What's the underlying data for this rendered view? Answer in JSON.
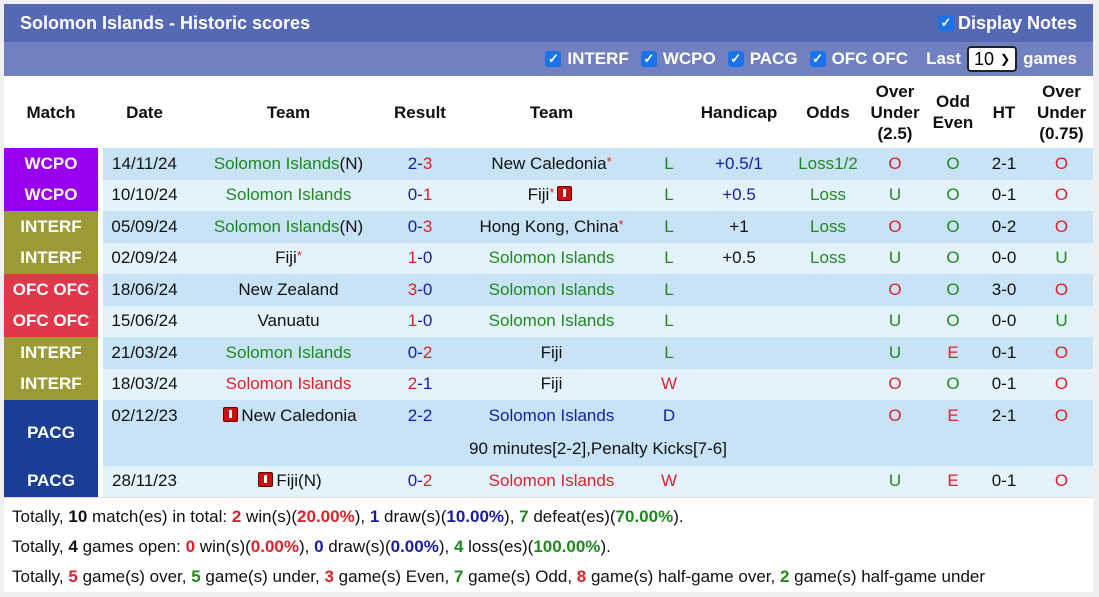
{
  "header": {
    "title": "Solomon Islands - Historic scores",
    "display_notes_label": "Display Notes",
    "display_notes_checked": true
  },
  "filters": {
    "items": [
      {
        "label": "INTERF",
        "checked": true
      },
      {
        "label": "WCPO",
        "checked": true
      },
      {
        "label": "PACG",
        "checked": true
      },
      {
        "label": "OFC OFC",
        "checked": true
      }
    ],
    "last_label": "Last",
    "last_value": "10",
    "games_label": "games"
  },
  "columns": {
    "match": "Match",
    "date": "Date",
    "team_home": "Team",
    "result": "Result",
    "team_away": "Team",
    "handicap": "Handicap",
    "odds": "Odds",
    "ou_line1": "Over",
    "ou_line2": "Under",
    "ou_line3": "(2.5)",
    "oe_line1": "Odd",
    "oe_line2": "Even",
    "ht": "HT",
    "ou2_line1": "Over",
    "ou2_line2": "Under",
    "ou2_line3": "(0.75)"
  },
  "colors": {
    "WCPO": "#9a00f0",
    "INTERF": "#9b9b35",
    "OFC OFC": "#e0384a",
    "PACG": "#1a3d96"
  },
  "rows": [
    {
      "league": "WCPO",
      "date": "14/11/24",
      "home": "Solomon Islands",
      "home_suffix": "(N)",
      "home_color": "green",
      "home_star": false,
      "home_card": false,
      "score_h": "2",
      "score_a": "3",
      "score_h_color": "navy",
      "score_a_color": "red",
      "away": "New Caledonia",
      "away_color": "black",
      "away_star": true,
      "away_card": false,
      "wl": "L",
      "wl_color": "green",
      "handicap": "+0.5/1",
      "handicap_color": "navy",
      "odds": "Loss1/2",
      "ou": "O",
      "ou_color": "red",
      "oe": "O",
      "oe_color": "green",
      "ht": "2-1",
      "ou2": "O",
      "ou2_color": "red"
    },
    {
      "league": "WCPO",
      "date": "10/10/24",
      "home": "Solomon Islands",
      "home_suffix": "",
      "home_color": "green",
      "home_star": false,
      "home_card": false,
      "score_h": "0",
      "score_a": "1",
      "score_h_color": "navy",
      "score_a_color": "red",
      "away": "Fiji",
      "away_color": "black",
      "away_star": true,
      "away_card": true,
      "wl": "L",
      "wl_color": "green",
      "handicap": "+0.5",
      "handicap_color": "navy",
      "odds": "Loss",
      "ou": "U",
      "ou_color": "green",
      "oe": "O",
      "oe_color": "green",
      "ht": "0-1",
      "ou2": "O",
      "ou2_color": "red"
    },
    {
      "league": "INTERF",
      "date": "05/09/24",
      "home": "Solomon Islands",
      "home_suffix": "(N)",
      "home_color": "green",
      "home_star": false,
      "home_card": false,
      "score_h": "0",
      "score_a": "3",
      "score_h_color": "navy",
      "score_a_color": "red",
      "away": "Hong Kong, China",
      "away_color": "black",
      "away_star": true,
      "away_card": false,
      "wl": "L",
      "wl_color": "green",
      "handicap": "+1",
      "handicap_color": "black",
      "odds": "Loss",
      "ou": "O",
      "ou_color": "red",
      "oe": "O",
      "oe_color": "green",
      "ht": "0-2",
      "ou2": "O",
      "ou2_color": "red"
    },
    {
      "league": "INTERF",
      "date": "02/09/24",
      "home": "Fiji",
      "home_suffix": "",
      "home_color": "black",
      "home_star": true,
      "home_card": false,
      "score_h": "1",
      "score_a": "0",
      "score_h_color": "red",
      "score_a_color": "navy",
      "away": "Solomon Islands",
      "away_color": "green",
      "away_star": false,
      "away_card": false,
      "wl": "L",
      "wl_color": "green",
      "handicap": "+0.5",
      "handicap_color": "black",
      "odds": "Loss",
      "ou": "U",
      "ou_color": "green",
      "oe": "O",
      "oe_color": "green",
      "ht": "0-0",
      "ou2": "U",
      "ou2_color": "green"
    },
    {
      "league": "OFC OFC",
      "date": "18/06/24",
      "home": "New Zealand",
      "home_suffix": "",
      "home_color": "black",
      "home_star": false,
      "home_card": false,
      "score_h": "3",
      "score_a": "0",
      "score_h_color": "red",
      "score_a_color": "navy",
      "away": "Solomon Islands",
      "away_color": "green",
      "away_star": false,
      "away_card": false,
      "wl": "L",
      "wl_color": "green",
      "handicap": "",
      "handicap_color": "black",
      "odds": "",
      "ou": "O",
      "ou_color": "red",
      "oe": "O",
      "oe_color": "green",
      "ht": "3-0",
      "ou2": "O",
      "ou2_color": "red"
    },
    {
      "league": "OFC OFC",
      "date": "15/06/24",
      "home": "Vanuatu",
      "home_suffix": "",
      "home_color": "black",
      "home_star": false,
      "home_card": false,
      "score_h": "1",
      "score_a": "0",
      "score_h_color": "red",
      "score_a_color": "navy",
      "away": "Solomon Islands",
      "away_color": "green",
      "away_star": false,
      "away_card": false,
      "wl": "L",
      "wl_color": "green",
      "handicap": "",
      "handicap_color": "black",
      "odds": "",
      "ou": "U",
      "ou_color": "green",
      "oe": "O",
      "oe_color": "green",
      "ht": "0-0",
      "ou2": "U",
      "ou2_color": "green"
    },
    {
      "league": "INTERF",
      "date": "21/03/24",
      "home": "Solomon Islands",
      "home_suffix": "",
      "home_color": "green",
      "home_star": false,
      "home_card": false,
      "score_h": "0",
      "score_a": "2",
      "score_h_color": "navy",
      "score_a_color": "red",
      "away": "Fiji",
      "away_color": "black",
      "away_star": false,
      "away_card": false,
      "wl": "L",
      "wl_color": "green",
      "handicap": "",
      "handicap_color": "black",
      "odds": "",
      "ou": "U",
      "ou_color": "green",
      "oe": "E",
      "oe_color": "red",
      "ht": "0-1",
      "ou2": "O",
      "ou2_color": "red"
    },
    {
      "league": "INTERF",
      "date": "18/03/24",
      "home": "Solomon Islands",
      "home_suffix": "",
      "home_color": "red",
      "home_star": false,
      "home_card": false,
      "score_h": "2",
      "score_a": "1",
      "score_h_color": "red",
      "score_a_color": "navy",
      "away": "Fiji",
      "away_color": "black",
      "away_star": false,
      "away_card": false,
      "wl": "W",
      "wl_color": "red",
      "handicap": "",
      "handicap_color": "black",
      "odds": "",
      "ou": "O",
      "ou_color": "red",
      "oe": "O",
      "oe_color": "green",
      "ht": "0-1",
      "ou2": "O",
      "ou2_color": "red"
    },
    {
      "league": "PACG",
      "date": "02/12/23",
      "home": "New Caledonia",
      "home_suffix": "",
      "home_color": "black",
      "home_star": false,
      "home_card": true,
      "score_h": "2",
      "score_a": "2",
      "score_h_color": "navy",
      "score_a_color": "navy",
      "away": "Solomon Islands",
      "away_color": "navy",
      "away_star": false,
      "away_card": false,
      "wl": "D",
      "wl_color": "navy",
      "handicap": "",
      "handicap_color": "black",
      "odds": "",
      "ou": "O",
      "ou_color": "red",
      "oe": "E",
      "oe_color": "red",
      "ht": "2-1",
      "ou2": "O",
      "ou2_color": "red",
      "note": "90 minutes[2-2],Penalty Kicks[7-6]"
    },
    {
      "league": "PACG",
      "date": "28/11/23",
      "home": "Fiji",
      "home_suffix": "(N)",
      "home_color": "black",
      "home_star": false,
      "home_card": true,
      "score_h": "0",
      "score_a": "2",
      "score_h_color": "navy",
      "score_a_color": "red",
      "away": "Solomon Islands",
      "away_color": "red",
      "away_star": false,
      "away_card": false,
      "wl": "W",
      "wl_color": "red",
      "handicap": "",
      "handicap_color": "black",
      "odds": "",
      "ou": "U",
      "ou_color": "green",
      "oe": "E",
      "oe_color": "red",
      "ht": "0-1",
      "ou2": "O",
      "ou2_color": "red"
    }
  ],
  "summary": [
    [
      {
        "t": "Totally, ",
        "c": "black",
        "b": false
      },
      {
        "t": "10",
        "c": "black",
        "b": true
      },
      {
        "t": " match(es) in total: ",
        "c": "black",
        "b": false
      },
      {
        "t": "2",
        "c": "red",
        "b": true
      },
      {
        "t": " win(s)(",
        "c": "black",
        "b": false
      },
      {
        "t": "20.00%",
        "c": "red",
        "b": true
      },
      {
        "t": "), ",
        "c": "black",
        "b": false
      },
      {
        "t": "1",
        "c": "navy",
        "b": true
      },
      {
        "t": " draw(s)(",
        "c": "black",
        "b": false
      },
      {
        "t": "10.00%",
        "c": "navy",
        "b": true
      },
      {
        "t": "), ",
        "c": "black",
        "b": false
      },
      {
        "t": "7",
        "c": "green",
        "b": true
      },
      {
        "t": " defeat(es)(",
        "c": "black",
        "b": false
      },
      {
        "t": "70.00%",
        "c": "green",
        "b": true
      },
      {
        "t": ").",
        "c": "black",
        "b": false
      }
    ],
    [
      {
        "t": "Totally, ",
        "c": "black",
        "b": false
      },
      {
        "t": "4",
        "c": "black",
        "b": true
      },
      {
        "t": " games open: ",
        "c": "black",
        "b": false
      },
      {
        "t": "0",
        "c": "red",
        "b": true
      },
      {
        "t": " win(s)(",
        "c": "black",
        "b": false
      },
      {
        "t": "0.00%",
        "c": "red",
        "b": true
      },
      {
        "t": "), ",
        "c": "black",
        "b": false
      },
      {
        "t": "0",
        "c": "navy",
        "b": true
      },
      {
        "t": " draw(s)(",
        "c": "black",
        "b": false
      },
      {
        "t": "0.00%",
        "c": "navy",
        "b": true
      },
      {
        "t": "), ",
        "c": "black",
        "b": false
      },
      {
        "t": "4",
        "c": "green",
        "b": true
      },
      {
        "t": " loss(es)(",
        "c": "black",
        "b": false
      },
      {
        "t": "100.00%",
        "c": "green",
        "b": true
      },
      {
        "t": ").",
        "c": "black",
        "b": false
      }
    ],
    [
      {
        "t": "Totally, ",
        "c": "black",
        "b": false
      },
      {
        "t": "5",
        "c": "red",
        "b": true
      },
      {
        "t": " game(s) over, ",
        "c": "black",
        "b": false
      },
      {
        "t": "5",
        "c": "green",
        "b": true
      },
      {
        "t": " game(s) under, ",
        "c": "black",
        "b": false
      },
      {
        "t": "3",
        "c": "red",
        "b": true
      },
      {
        "t": " game(s) Even, ",
        "c": "black",
        "b": false
      },
      {
        "t": "7",
        "c": "green",
        "b": true
      },
      {
        "t": " game(s) Odd, ",
        "c": "black",
        "b": false
      },
      {
        "t": "8",
        "c": "red",
        "b": true
      },
      {
        "t": " game(s) half-game over, ",
        "c": "black",
        "b": false
      },
      {
        "t": "2",
        "c": "green",
        "b": true
      },
      {
        "t": " game(s) half-game under",
        "c": "black",
        "b": false
      }
    ]
  ]
}
